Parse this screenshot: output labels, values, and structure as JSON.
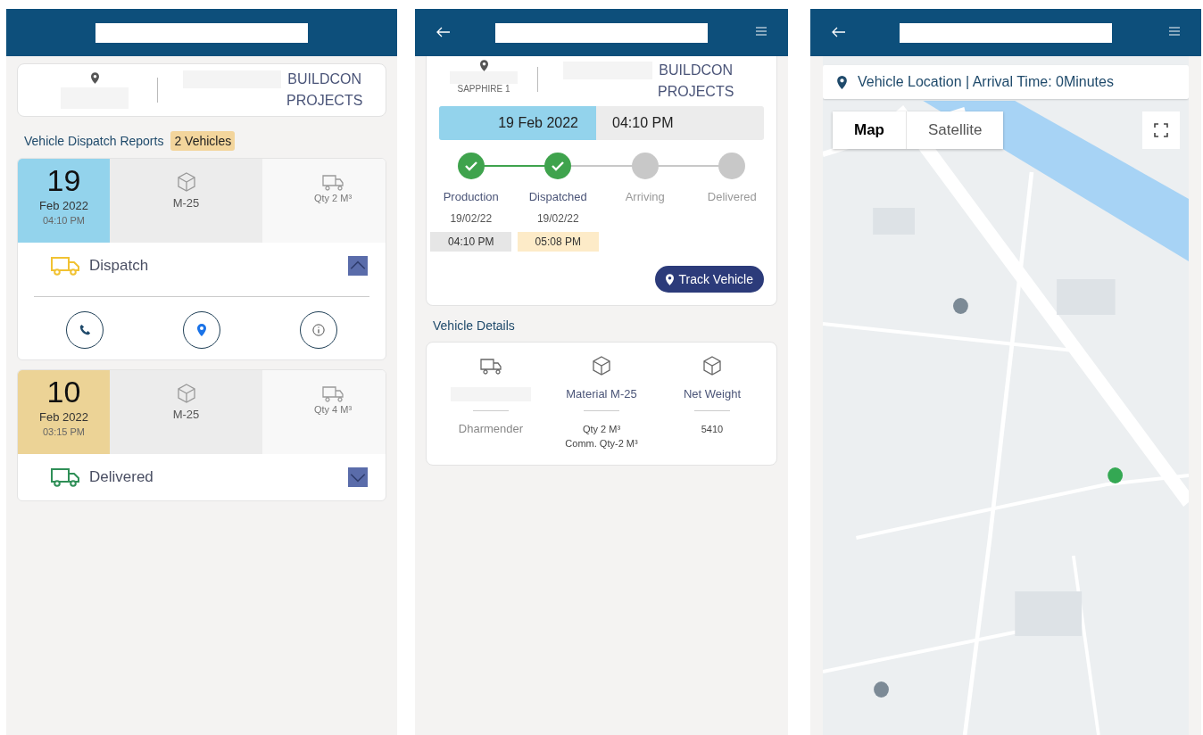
{
  "list_screen": {
    "site": {
      "company": [
        "BUILDCON",
        "PROJECTS"
      ]
    },
    "section_title": "Vehicle Dispatch Reports",
    "badge": "2 Vehicles",
    "dispatches": [
      {
        "day": "19",
        "month_year": "Feb 2022",
        "time": "04:10 PM",
        "color": "#93d3ec",
        "material": "M-25",
        "qty": "Qty 2 M³",
        "kind": "dispatch",
        "status": "Dispatch",
        "expanded": true
      },
      {
        "day": "10",
        "month_year": "Feb 2022",
        "time": "03:15 PM",
        "color": "#ecd396",
        "material": "M-25",
        "qty": "Qty 4 M³",
        "kind": "delivered",
        "status": "Delivered",
        "expanded": false
      }
    ]
  },
  "detail_screen": {
    "header": {
      "back": true,
      "menu": true
    },
    "site": {
      "location": "SAPPHIRE 1",
      "company": [
        "BUILDCON",
        "PROJECTS"
      ]
    },
    "date": "19 Feb 2022",
    "time": "04:10 PM",
    "steps": [
      {
        "label": "Production",
        "done": true,
        "date": "19/02/22",
        "time": "04:10 PM",
        "color": "#e6e6e6"
      },
      {
        "label": "Dispatched",
        "done": true,
        "date": "19/02/22",
        "time": "05:08 PM",
        "color": "#fdebc8"
      },
      {
        "label": "Arriving",
        "done": false
      },
      {
        "label": "Delivered",
        "done": false
      }
    ],
    "track_button": "Track Vehicle",
    "details_title": "Vehicle Details",
    "details": [
      {
        "kind": "truck",
        "values": [
          "Dharmender"
        ]
      },
      {
        "kind": "box",
        "title": "Material M-25",
        "values": [
          "Qty 2 M³",
          "Comm. Qty-2 M³"
        ]
      },
      {
        "kind": "box",
        "title": "Net Weight",
        "values": [
          "5410"
        ]
      }
    ]
  },
  "map_screen": {
    "header": {
      "back": true,
      "menu": true
    },
    "location_bar": "Vehicle Location | Arrival Time: 0Minutes",
    "map_types": [
      {
        "label": "Map",
        "selected": true
      },
      {
        "label": "Satellite",
        "selected": false
      }
    ]
  }
}
